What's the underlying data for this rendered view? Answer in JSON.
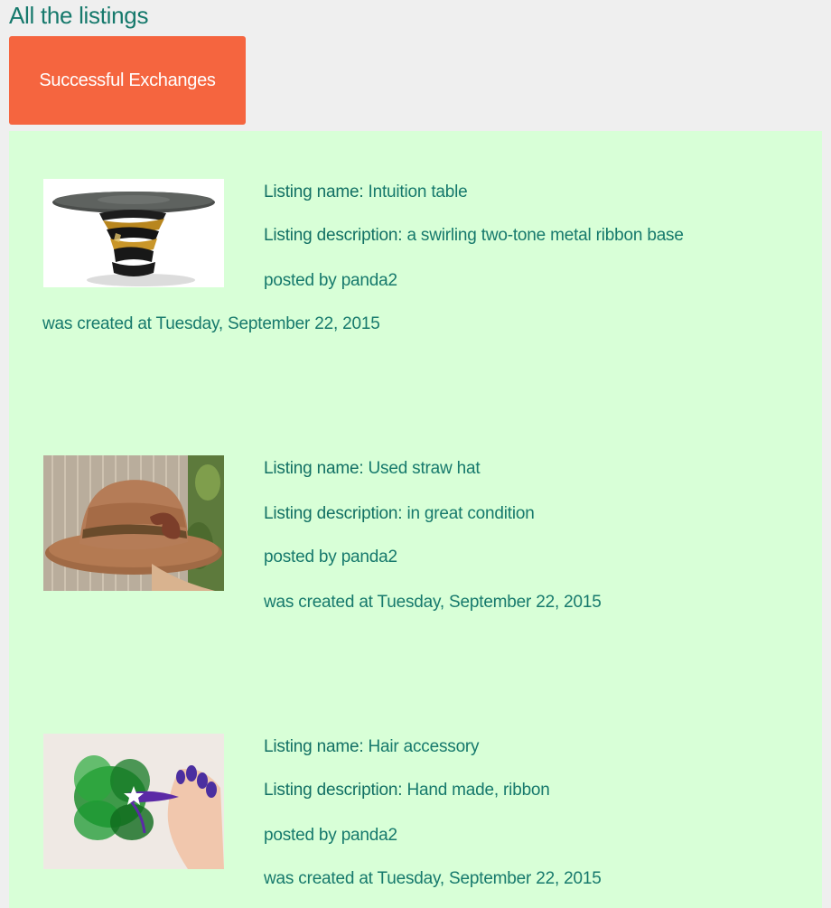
{
  "page": {
    "title": "All the listings"
  },
  "toolbar": {
    "exchanges_label": "Successful Exchanges"
  },
  "labels": {
    "name": "Listing name:",
    "description": "Listing description:",
    "posted_by": "posted by",
    "created_at": "was created at"
  },
  "listings": [
    {
      "name": "Intuition table",
      "description": "a swirling two-tone metal ribbon base",
      "poster": "panda2",
      "created": "Tuesday, September 22, 2015",
      "image_icon": "table-image"
    },
    {
      "name": "Used straw hat",
      "description": "in great condition",
      "poster": "panda2",
      "created": "Tuesday, September 22, 2015",
      "image_icon": "hat-image"
    },
    {
      "name": "Hair accessory",
      "description": "Hand made, ribbon",
      "poster": "panda2",
      "created": "Tuesday, September 22, 2015",
      "image_icon": "hair-accessory-image"
    }
  ],
  "colors": {
    "background": "#efefef",
    "panel": "#d8ffd7",
    "accent": "#f5653f",
    "text": "#16796c"
  }
}
